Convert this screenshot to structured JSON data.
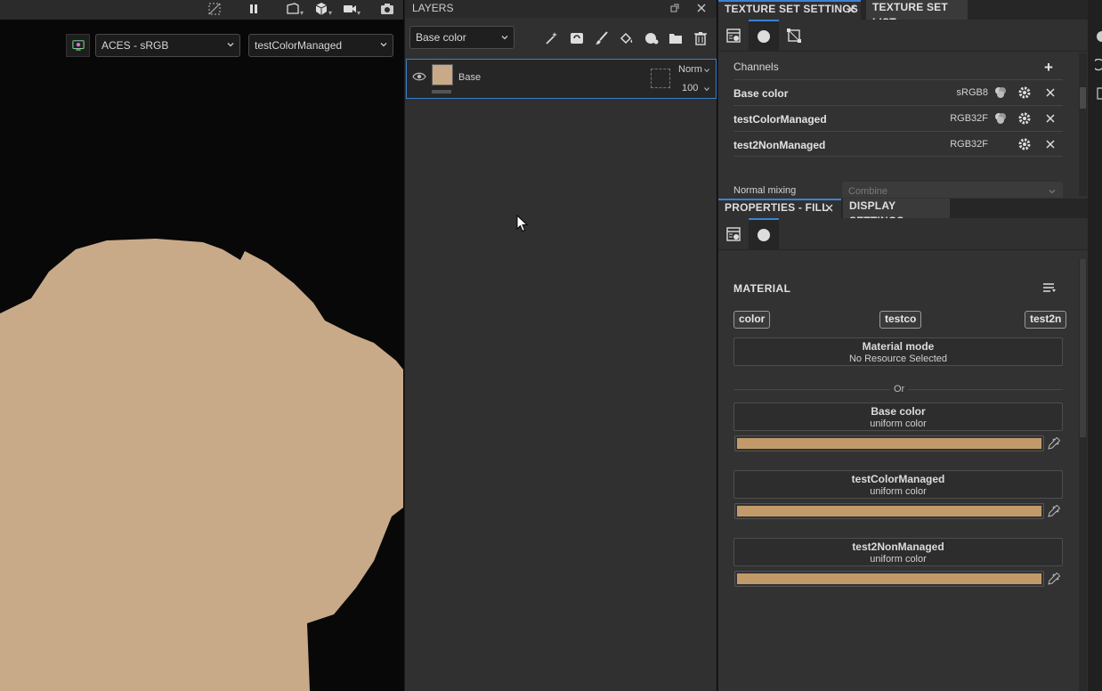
{
  "viewport": {
    "toolbar_icons": [
      "hide-icon",
      "pause-icon",
      "perspective-icon",
      "cube-icon",
      "camera-video-icon",
      "screenshot-icon"
    ],
    "colorspace_select": "ACES - sRGB",
    "channel_view_select": "testColorManaged",
    "mesh_color": "#c9aa88"
  },
  "layers": {
    "title": "LAYERS",
    "channel_select": "Base color",
    "tools": [
      "magic-wand-icon",
      "generator-icon",
      "brush-icon",
      "fill-icon",
      "smart-material-icon",
      "folder-icon",
      "trash-icon"
    ],
    "items": [
      {
        "name": "Base",
        "blend": "Norm",
        "opacity": "100",
        "thumb_color": "#c9aa88"
      }
    ]
  },
  "texture_set_settings": {
    "tab_label": "TEXTURE SET SETTINGS",
    "tab2_label": "TEXTURE SET LIST",
    "channels_header": "Channels",
    "add_label": "+",
    "channels": [
      {
        "name": "Base color",
        "format": "sRGB8",
        "has_colorspace": true
      },
      {
        "name": "testColorManaged",
        "format": "RGB32F",
        "has_colorspace": true
      },
      {
        "name": "test2NonManaged",
        "format": "RGB32F",
        "has_colorspace": false
      }
    ],
    "normal_mixing_label": "Normal mixing",
    "normal_mixing_value": "Combine"
  },
  "properties": {
    "tab_label": "PROPERTIES - FILL",
    "tab2_label": "DISPLAY SETTINGS",
    "material_title": "MATERIAL",
    "tags": [
      "color",
      "testco",
      "test2n"
    ],
    "material_mode_title": "Material mode",
    "material_mode_value": "No Resource Selected",
    "or_label": "Or",
    "slots": [
      {
        "title": "Base color",
        "subtitle": "uniform color",
        "color": "#c29a6a"
      },
      {
        "title": "testColorManaged",
        "subtitle": "uniform color",
        "color": "#c29a6a"
      },
      {
        "title": "test2NonManaged",
        "subtitle": "uniform color",
        "color": "#c29a6a"
      }
    ]
  }
}
